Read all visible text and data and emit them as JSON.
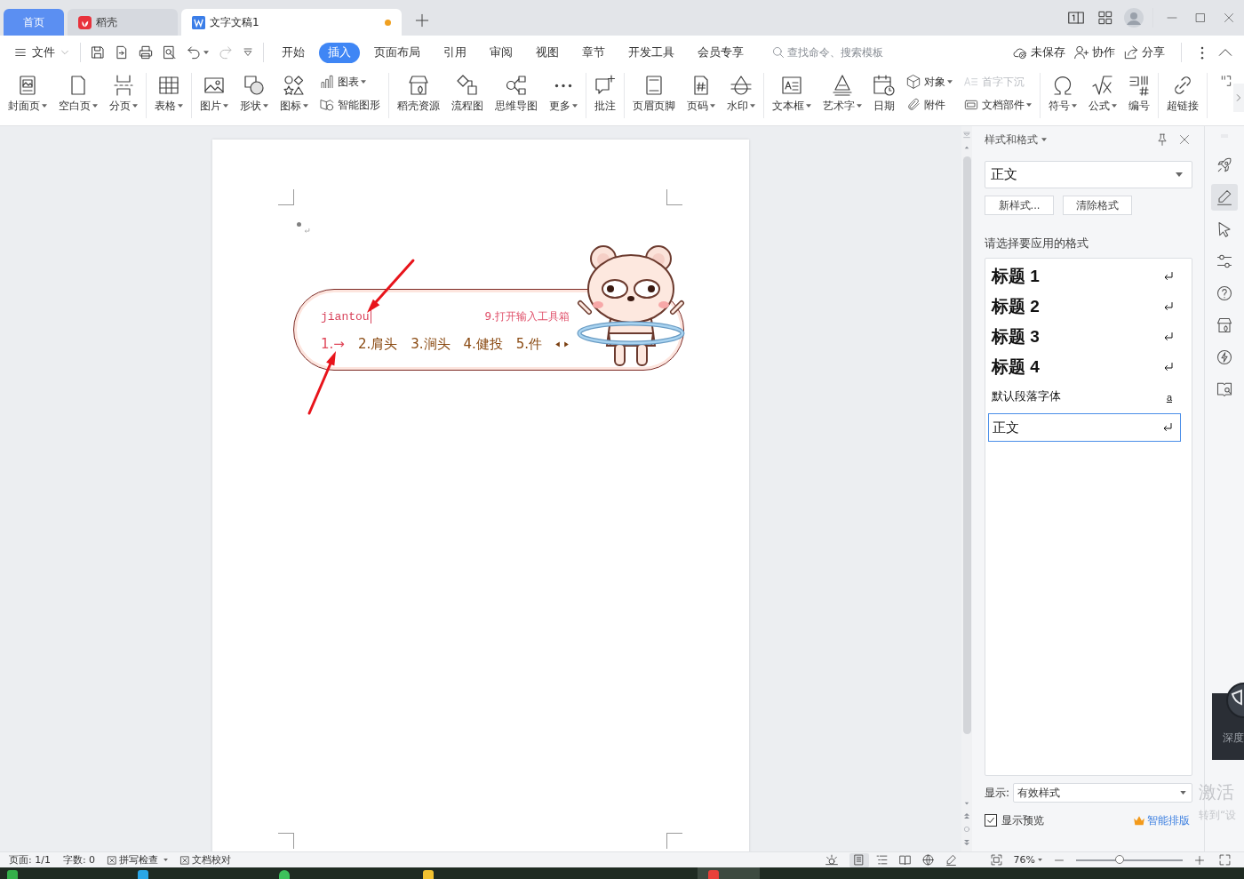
{
  "title_bar": {
    "tabs": [
      {
        "label": "首页",
        "kind": "home",
        "selected": false,
        "unsaved": false
      },
      {
        "label": "稻壳",
        "kind": "docer",
        "selected": false,
        "unsaved": false
      },
      {
        "label": "文字文稿1",
        "kind": "writer",
        "selected": true,
        "unsaved": true
      }
    ]
  },
  "menu_bar": {
    "file_menu": "文件",
    "tabs": [
      {
        "label": "开始",
        "selected": false
      },
      {
        "label": "插入",
        "selected": true
      },
      {
        "label": "页面布局",
        "selected": false
      },
      {
        "label": "引用",
        "selected": false
      },
      {
        "label": "审阅",
        "selected": false
      },
      {
        "label": "视图",
        "selected": false
      },
      {
        "label": "章节",
        "selected": false
      },
      {
        "label": "开发工具",
        "selected": false
      },
      {
        "label": "会员专享",
        "selected": false
      }
    ],
    "search": {
      "placeholder": "查找命令、搜索模板"
    },
    "actions": [
      "未保存",
      "协作",
      "分享"
    ]
  },
  "ribbon": {
    "groups": [
      {
        "items": [
          {
            "kind": "large",
            "label": "封面页",
            "dropdown": true
          },
          {
            "kind": "large",
            "label": "空白页",
            "dropdown": true
          },
          {
            "kind": "large",
            "label": "分页",
            "dropdown": true
          }
        ]
      },
      {
        "items": [
          {
            "kind": "large",
            "label": "表格",
            "dropdown": true
          }
        ]
      },
      {
        "items": [
          {
            "kind": "large",
            "label": "图片",
            "dropdown": true
          },
          {
            "kind": "large",
            "label": "形状",
            "dropdown": true
          },
          {
            "kind": "large",
            "label": "图标",
            "dropdown": true
          },
          {
            "kind": "stack",
            "rows": [
              {
                "label": "图表",
                "dropdown": true,
                "disabled": false
              },
              {
                "label": "智能图形",
                "dropdown": false,
                "disabled": false
              }
            ]
          }
        ]
      },
      {
        "items": [
          {
            "kind": "large",
            "label": "稻壳资源",
            "dropdown": false
          },
          {
            "kind": "large",
            "label": "流程图",
            "dropdown": false
          },
          {
            "kind": "large",
            "label": "思维导图",
            "dropdown": false
          },
          {
            "kind": "large",
            "label": "更多",
            "dropdown": true
          }
        ]
      },
      {
        "items": [
          {
            "kind": "large",
            "label": "批注",
            "dropdown": false
          }
        ]
      },
      {
        "items": [
          {
            "kind": "large",
            "label": "页眉页脚",
            "dropdown": false
          },
          {
            "kind": "large",
            "label": "页码",
            "dropdown": true
          },
          {
            "kind": "large",
            "label": "水印",
            "dropdown": true
          }
        ]
      },
      {
        "items": [
          {
            "kind": "large",
            "label": "文本框",
            "dropdown": true
          },
          {
            "kind": "large",
            "label": "艺术字",
            "dropdown": true
          },
          {
            "kind": "large",
            "label": "日期",
            "dropdown": false
          },
          {
            "kind": "stack",
            "rows": [
              {
                "label": "对象",
                "dropdown": true,
                "disabled": false
              },
              {
                "label": "附件",
                "dropdown": false,
                "disabled": false
              }
            ]
          },
          {
            "kind": "stack",
            "rows": [
              {
                "label": "首字下沉",
                "dropdown": false,
                "disabled": true
              },
              {
                "label": "文档部件",
                "dropdown": true,
                "disabled": false
              }
            ]
          }
        ]
      },
      {
        "items": [
          {
            "kind": "large",
            "label": "符号",
            "dropdown": true
          },
          {
            "kind": "large",
            "label": "公式",
            "dropdown": true
          },
          {
            "kind": "large",
            "label": "编号",
            "dropdown": false
          }
        ]
      },
      {
        "items": [
          {
            "kind": "large",
            "label": "超链接",
            "dropdown": false
          }
        ]
      }
    ]
  },
  "document": {
    "ime": {
      "input": "jiantou",
      "hint": "9.打开输入工具箱",
      "candidates": [
        {
          "label": "1.→",
          "selected": true
        },
        {
          "label": "2.肩头",
          "selected": false
        },
        {
          "label": "3.涧头",
          "selected": false
        },
        {
          "label": "4.健投",
          "selected": false
        },
        {
          "label": "5.件",
          "selected": false
        }
      ]
    }
  },
  "styles_panel": {
    "title": "样式和格式",
    "current_style": "正文",
    "buttons": [
      "新样式...",
      "清除格式"
    ],
    "prompt": "请选择要应用的格式",
    "styles": [
      {
        "label": "标题 1",
        "kind": "heading",
        "selected": false
      },
      {
        "label": "标题 2",
        "kind": "heading",
        "selected": false
      },
      {
        "label": "标题 3",
        "kind": "heading",
        "selected": false
      },
      {
        "label": "标题 4",
        "kind": "heading",
        "selected": false
      },
      {
        "label": "默认段落字体",
        "kind": "character",
        "marker": "a",
        "selected": false
      },
      {
        "label": "正文",
        "kind": "paragraph",
        "selected": true
      }
    ],
    "show": {
      "label": "显示:",
      "value": "有效样式"
    },
    "preview": {
      "label": "显示预览",
      "checked": true
    },
    "smart_layout": "智能排版"
  },
  "side_rail": {
    "tools": [
      {
        "selected": false
      },
      {
        "selected": true
      },
      {
        "selected": false
      },
      {
        "selected": false
      },
      {
        "selected": false
      },
      {
        "selected": false
      },
      {
        "selected": false
      },
      {
        "selected": false
      }
    ]
  },
  "notices": {
    "popup_label": "深度",
    "activation_title": "激活",
    "activation_hint": "转到“设"
  },
  "status_bar": {
    "page": "页面: 1/1",
    "words": "字数: 0",
    "spell_check": "拼写检查",
    "proofread": "文档校对",
    "views": [
      {
        "selected": true
      },
      {
        "selected": false
      },
      {
        "selected": false
      },
      {
        "selected": false
      }
    ],
    "zoom": "76%",
    "zoom_slider": {
      "level": 0.41
    }
  }
}
